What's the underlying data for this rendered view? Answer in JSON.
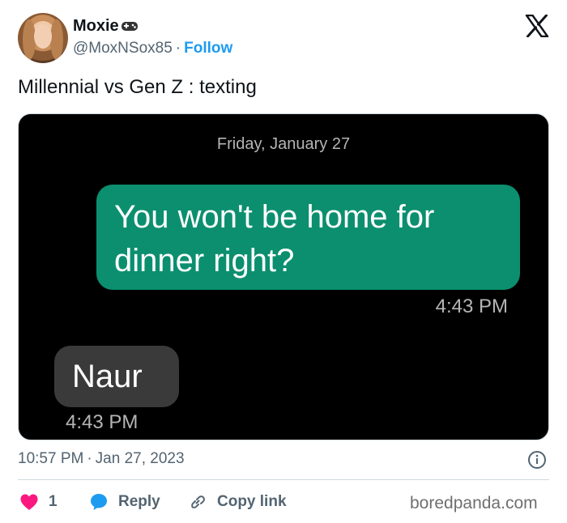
{
  "author": {
    "name": "Moxie",
    "name_emoji_icon": "gamepad-icon",
    "handle": "@MoxNSox85",
    "separator": "·",
    "follow_label": "Follow"
  },
  "brand_icon": "x-logo-icon",
  "tweet": {
    "text": "Millennial vs Gen Z : texting"
  },
  "media": {
    "date_header": "Friday, January 27",
    "outgoing_message": "You won't be home for dinner right?",
    "outgoing_time": "4:43 PM",
    "incoming_message": "Naur",
    "incoming_time": "4:43 PM",
    "colors": {
      "outgoing_bubble": "#0b8f6f",
      "incoming_bubble": "#3a3a3a",
      "background": "#000000"
    }
  },
  "meta": {
    "time": "10:57 PM",
    "separator": "·",
    "date": "Jan 27, 2023",
    "info_icon": "info-icon"
  },
  "actions": {
    "likes_count": "1",
    "reply_label": "Reply",
    "copy_link_label": "Copy link",
    "like_color": "#f91880",
    "reply_color": "#1d9bf0"
  },
  "watermark": "boredpanda.com"
}
